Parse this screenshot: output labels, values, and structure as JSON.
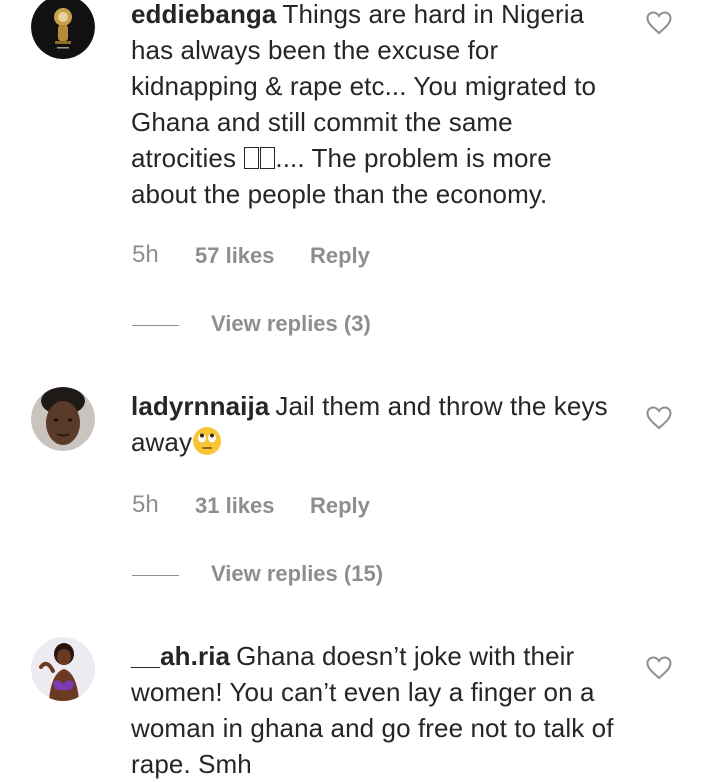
{
  "comments": [
    {
      "username": "eddiebanga",
      "text_part1": "Things are hard in Nigeria has always been the excuse for kidnapping & rape etc... You migrated to Ghana and still commit the same atrocities ",
      "emoji_note": "two unsupported emoji glyphs",
      "text_part2": ".... The problem is more about the people than the economy.",
      "time": "5h",
      "likes": "57 likes",
      "reply": "Reply",
      "view_replies": "View replies (3)",
      "avatar_icon": "avatar-logo-dark"
    },
    {
      "username": "ladyrnnaija",
      "text": "Jail them and throw the keys away",
      "emoji": "face-with-rolling-eyes",
      "time": "5h",
      "likes": "31 likes",
      "reply": "Reply",
      "view_replies": "View replies (15)",
      "avatar_icon": "avatar-photo-woman"
    },
    {
      "username": "__ah.ria",
      "text": "Ghana doesn’t joke with their women! You can’t even lay a finger on a woman in ghana and go free not to talk of rape. Smh",
      "avatar_icon": "avatar-photo-woman-purple"
    }
  ],
  "colors": {
    "text": "#262626",
    "muted": "#8e8e8e",
    "background": "#ffffff"
  }
}
